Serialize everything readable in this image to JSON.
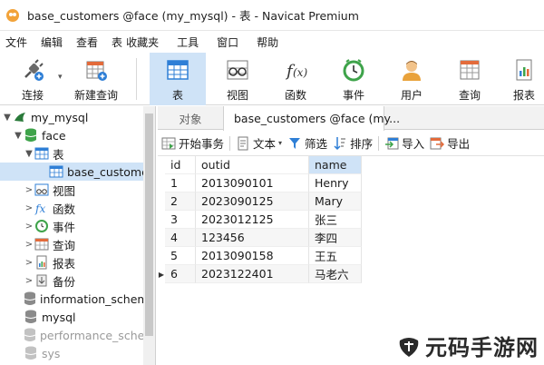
{
  "window": {
    "title": "base_customers @face (my_mysql) - 表 - Navicat Premium"
  },
  "menu": [
    "文件",
    "编辑",
    "查看",
    "表",
    "收藏夹",
    "工具",
    "窗口",
    "帮助"
  ],
  "toolbar": {
    "connect": "连接",
    "new_query": "新建查询",
    "table": "表",
    "view": "视图",
    "function": "函数",
    "event": "事件",
    "user": "用户",
    "query": "查询",
    "report": "报表",
    "active_item": "表"
  },
  "navigator": {
    "items": [
      {
        "label": "my_mysql",
        "icon": "mysql-connection-icon",
        "arrow": "▼"
      },
      {
        "label": "face",
        "icon": "database-icon",
        "arrow": "▼"
      },
      {
        "label": "表",
        "icon": "table-icon",
        "arrow": "▼"
      },
      {
        "label": "base_customers",
        "icon": "table-icon",
        "arrow": ""
      },
      {
        "label": "视图",
        "icon": "view-icon",
        "arrow": ">"
      },
      {
        "label": "函数",
        "icon": "function-icon",
        "arrow": ">"
      },
      {
        "label": "事件",
        "icon": "event-icon",
        "arrow": ">"
      },
      {
        "label": "查询",
        "icon": "query-icon",
        "arrow": ">"
      },
      {
        "label": "报表",
        "icon": "report-icon",
        "arrow": ">"
      },
      {
        "label": "备份",
        "icon": "backup-icon",
        "arrow": ">"
      },
      {
        "label": "information_schema",
        "icon": "database-icon",
        "arrow": ""
      },
      {
        "label": "mysql",
        "icon": "database-icon",
        "arrow": ""
      },
      {
        "label": "performance_schema",
        "icon": "database-icon",
        "arrow": ""
      },
      {
        "label": "sys",
        "icon": "database-icon",
        "arrow": ""
      }
    ]
  },
  "tabs": {
    "objects": "对象",
    "current": "base_customers @face (my..."
  },
  "data_toolbar": {
    "begin_transaction": "开始事务",
    "text": "文本",
    "filter": "筛选",
    "sort": "排序",
    "import": "导入",
    "export": "导出"
  },
  "grid": {
    "columns": [
      "id",
      "outid",
      "name"
    ],
    "rows": [
      [
        "1",
        "2013090101",
        "Henry"
      ],
      [
        "2",
        "2023090125",
        "Mary"
      ],
      [
        "3",
        "2023012125",
        "张三"
      ],
      [
        "4",
        "123456",
        "李四"
      ],
      [
        "5",
        "2013090158",
        "王五"
      ],
      [
        "6",
        "2023122401",
        "马老六"
      ]
    ],
    "current_row": 6
  },
  "watermark": "元码手游网",
  "colors": {
    "selection": "#cfe3f7",
    "accent_blue": "#2f7fd6",
    "green": "#3ea34a"
  }
}
